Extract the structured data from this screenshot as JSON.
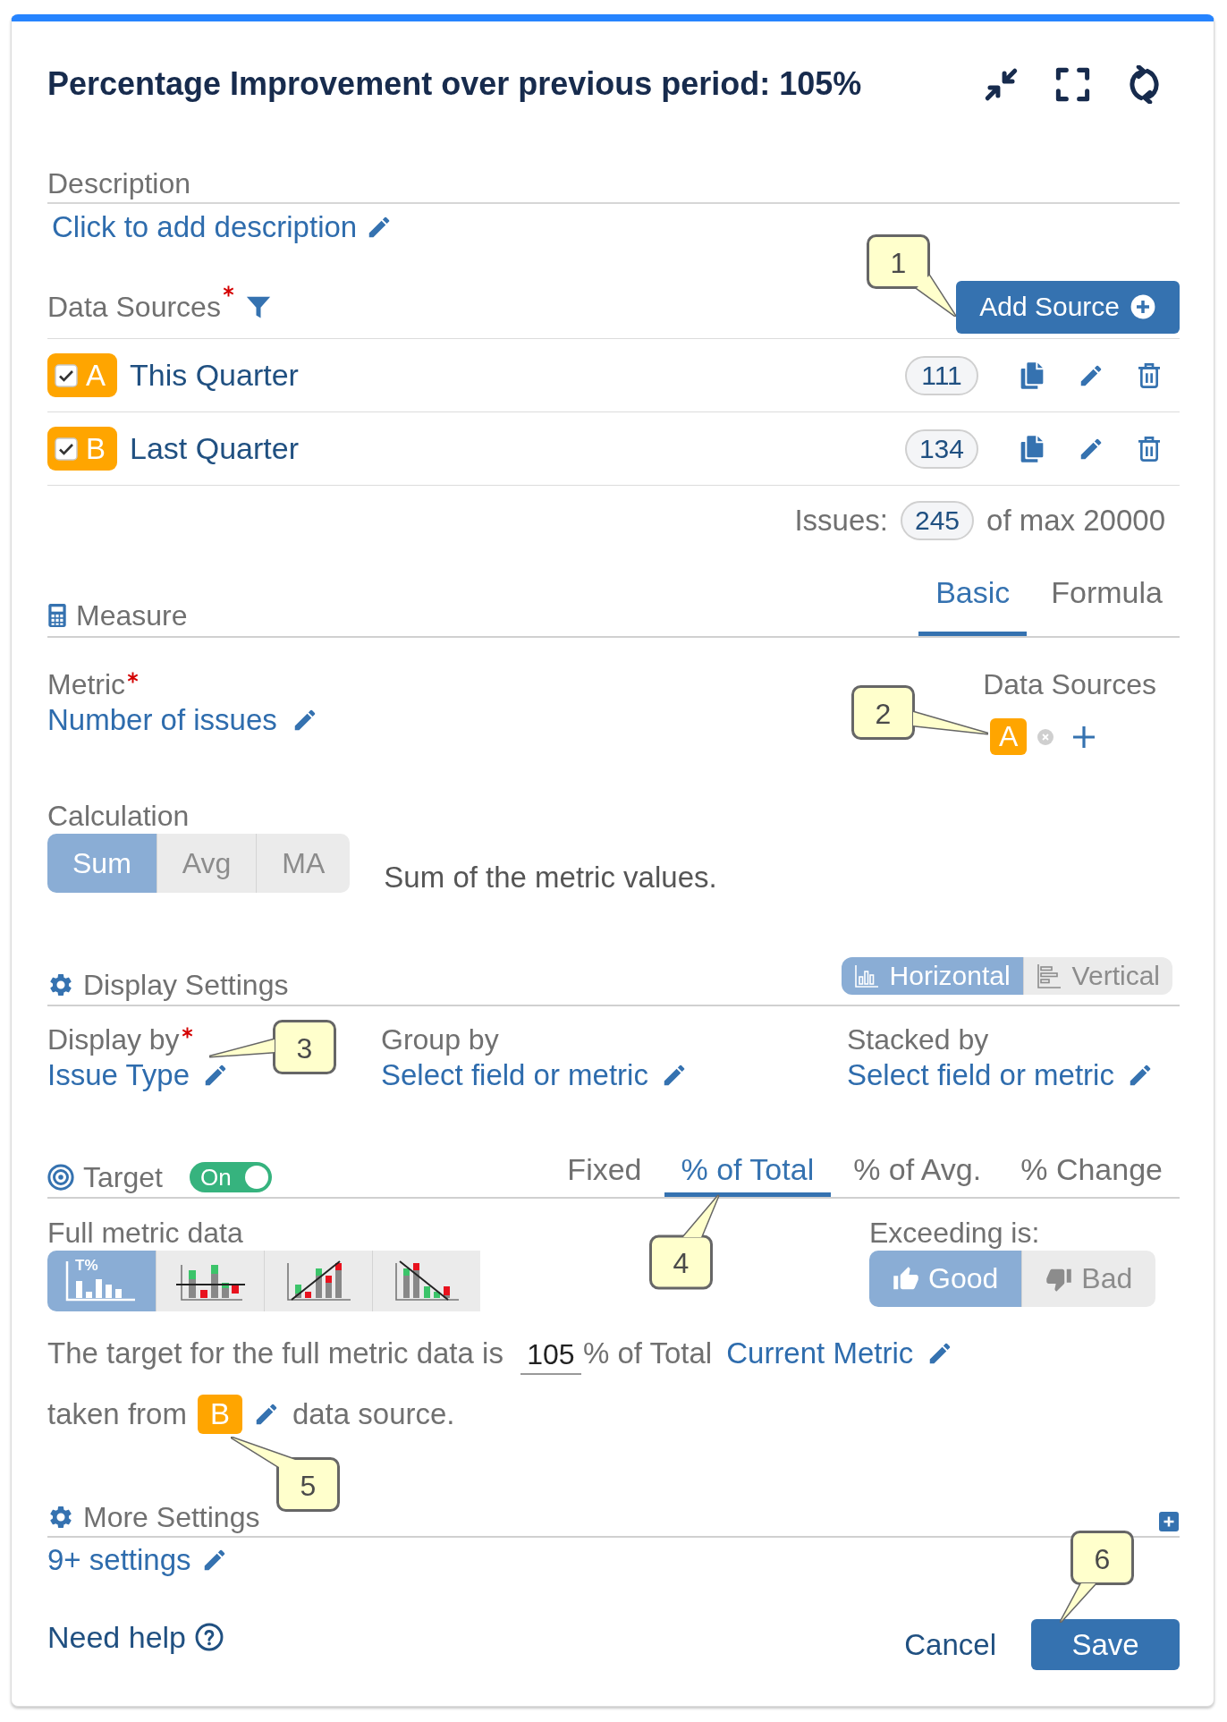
{
  "header": {
    "title": "Percentage Improvement over previous period: 105%"
  },
  "description": {
    "label": "Description",
    "link": "Click to add description"
  },
  "data_sources": {
    "label": "Data Sources",
    "required": true,
    "add_button": {
      "label": "Add Source",
      "callout": "1"
    },
    "items": [
      {
        "letter": "A",
        "name": "This Quarter",
        "checked": true,
        "count": "111"
      },
      {
        "letter": "B",
        "name": "Last Quarter",
        "checked": true,
        "count": "134"
      }
    ],
    "issues": {
      "label": "Issues:",
      "count": "245",
      "limit": "of max 20000"
    }
  },
  "measure": {
    "title": "Measure",
    "tabs": [
      {
        "label": "Basic",
        "selected": true
      },
      {
        "label": "Formula",
        "selected": false
      }
    ],
    "metric": {
      "label": "Metric",
      "required": true,
      "value": "Number of issues"
    },
    "sources": {
      "label": "Data Sources",
      "badges": [
        "A"
      ],
      "callout": "2"
    },
    "calculation": {
      "label": "Calculation",
      "options": [
        {
          "label": "Sum",
          "selected": true
        },
        {
          "label": "Avg",
          "selected": false
        },
        {
          "label": "MA",
          "selected": false
        }
      ],
      "description": "Sum of the metric values."
    }
  },
  "display_settings": {
    "title": "Display Settings",
    "orientation": [
      {
        "kind": "horizontal",
        "label": "Horizontal",
        "selected": true
      },
      {
        "kind": "vertical",
        "label": "Vertical",
        "selected": false
      }
    ],
    "fields": [
      {
        "label": "Display by",
        "required": true,
        "value": "Issue Type",
        "callout": "3"
      },
      {
        "label": "Group by",
        "value": "Select field or metric"
      },
      {
        "label": "Stacked by",
        "value": "Select field or metric"
      }
    ]
  },
  "target": {
    "title": "Target",
    "on": true,
    "switch_label": "On",
    "tabs": [
      {
        "label": "Fixed",
        "selected": false
      },
      {
        "label": "% of Total",
        "selected": true,
        "callout": "4"
      },
      {
        "label": "% of Avg.",
        "selected": false
      },
      {
        "label": "% Change",
        "selected": false
      }
    ],
    "full_metric": {
      "label": "Full metric data",
      "modes": [
        {
          "kind": "percent",
          "label": "T%",
          "selected": true
        },
        {
          "kind": "line",
          "selected": false
        },
        {
          "kind": "rising",
          "selected": false
        },
        {
          "kind": "falling",
          "selected": false
        }
      ]
    },
    "exceeding": {
      "label": "Exceeding is:",
      "options": [
        {
          "kind": "good",
          "label": "Good",
          "selected": true
        },
        {
          "kind": "bad",
          "label": "Bad",
          "selected": false
        }
      ]
    },
    "sentence": {
      "text": "The target for the full metric data is",
      "value": "105",
      "unit": "% of Total",
      "link": "Current Metric"
    },
    "source_line": {
      "before": "taken from",
      "badge": "B",
      "after": "data source.",
      "callout": "5"
    }
  },
  "more_settings": {
    "title": "More Settings",
    "link": "9+ settings"
  },
  "footer": {
    "help": "Need help",
    "cancel": "Cancel",
    "save": {
      "label": "Save",
      "callout": "6"
    }
  }
}
